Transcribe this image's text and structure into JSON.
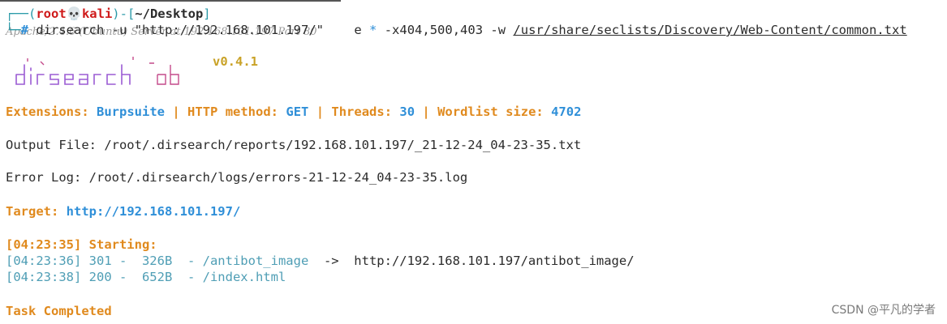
{
  "prompt": {
    "user": "root",
    "skull": "💀",
    "host": "kali",
    "cwd": "~/Desktop",
    "symbol": "#",
    "command_parts": {
      "cmd": "dirsearch",
      "flag_u": "-u",
      "url": "\"http://192.168.101.197/\"",
      "flag_e": "e",
      "star": "*",
      "flag_x": "-x404,500,403",
      "flag_w": "-w",
      "wordlist": "/usr/share/seclists/Discovery/Web-Content/common.txt"
    },
    "ghost_text": "Apache/2.4.6 (Ubuntu) Server at 192.168.101.197 Port 80"
  },
  "banner": {
    "version": "v0.4.1"
  },
  "config": {
    "extensions_label": "Extensions:",
    "extensions_value": "Burpsuite",
    "method_label": "HTTP method:",
    "method_value": "GET",
    "threads_label": "Threads:",
    "threads_value": "30",
    "wordlist_label": "Wordlist size:",
    "wordlist_value": "4702",
    "sep": "|"
  },
  "output_file": "Output File: /root/.dirsearch/reports/192.168.101.197/_21-12-24_04-23-35.txt",
  "error_log": "Error Log: /root/.dirsearch/logs/errors-21-12-24_04-23-35.log",
  "target": {
    "label": "Target:",
    "url": "http://192.168.101.197/"
  },
  "starting": "[04:23:35] Starting:",
  "results": [
    {
      "prefix": "[04:23:36] 301 -  326B  - /antibot_image",
      "arrow": "  ->  ",
      "redirect": "http://192.168.101.197/antibot_image/"
    },
    {
      "prefix": "[04:23:38] 200 -  652B  - /index.html",
      "arrow": "",
      "redirect": ""
    }
  ],
  "task_completed": "Task Completed",
  "watermark": "CSDN @平凡的学者",
  "colors": {
    "accent_blue": "#2f8fd8",
    "accent_orange": "#e08a1e",
    "prompt_red": "#cf1a1a",
    "result_teal": "#4f9eb5",
    "frame": "#2a9aa8"
  }
}
